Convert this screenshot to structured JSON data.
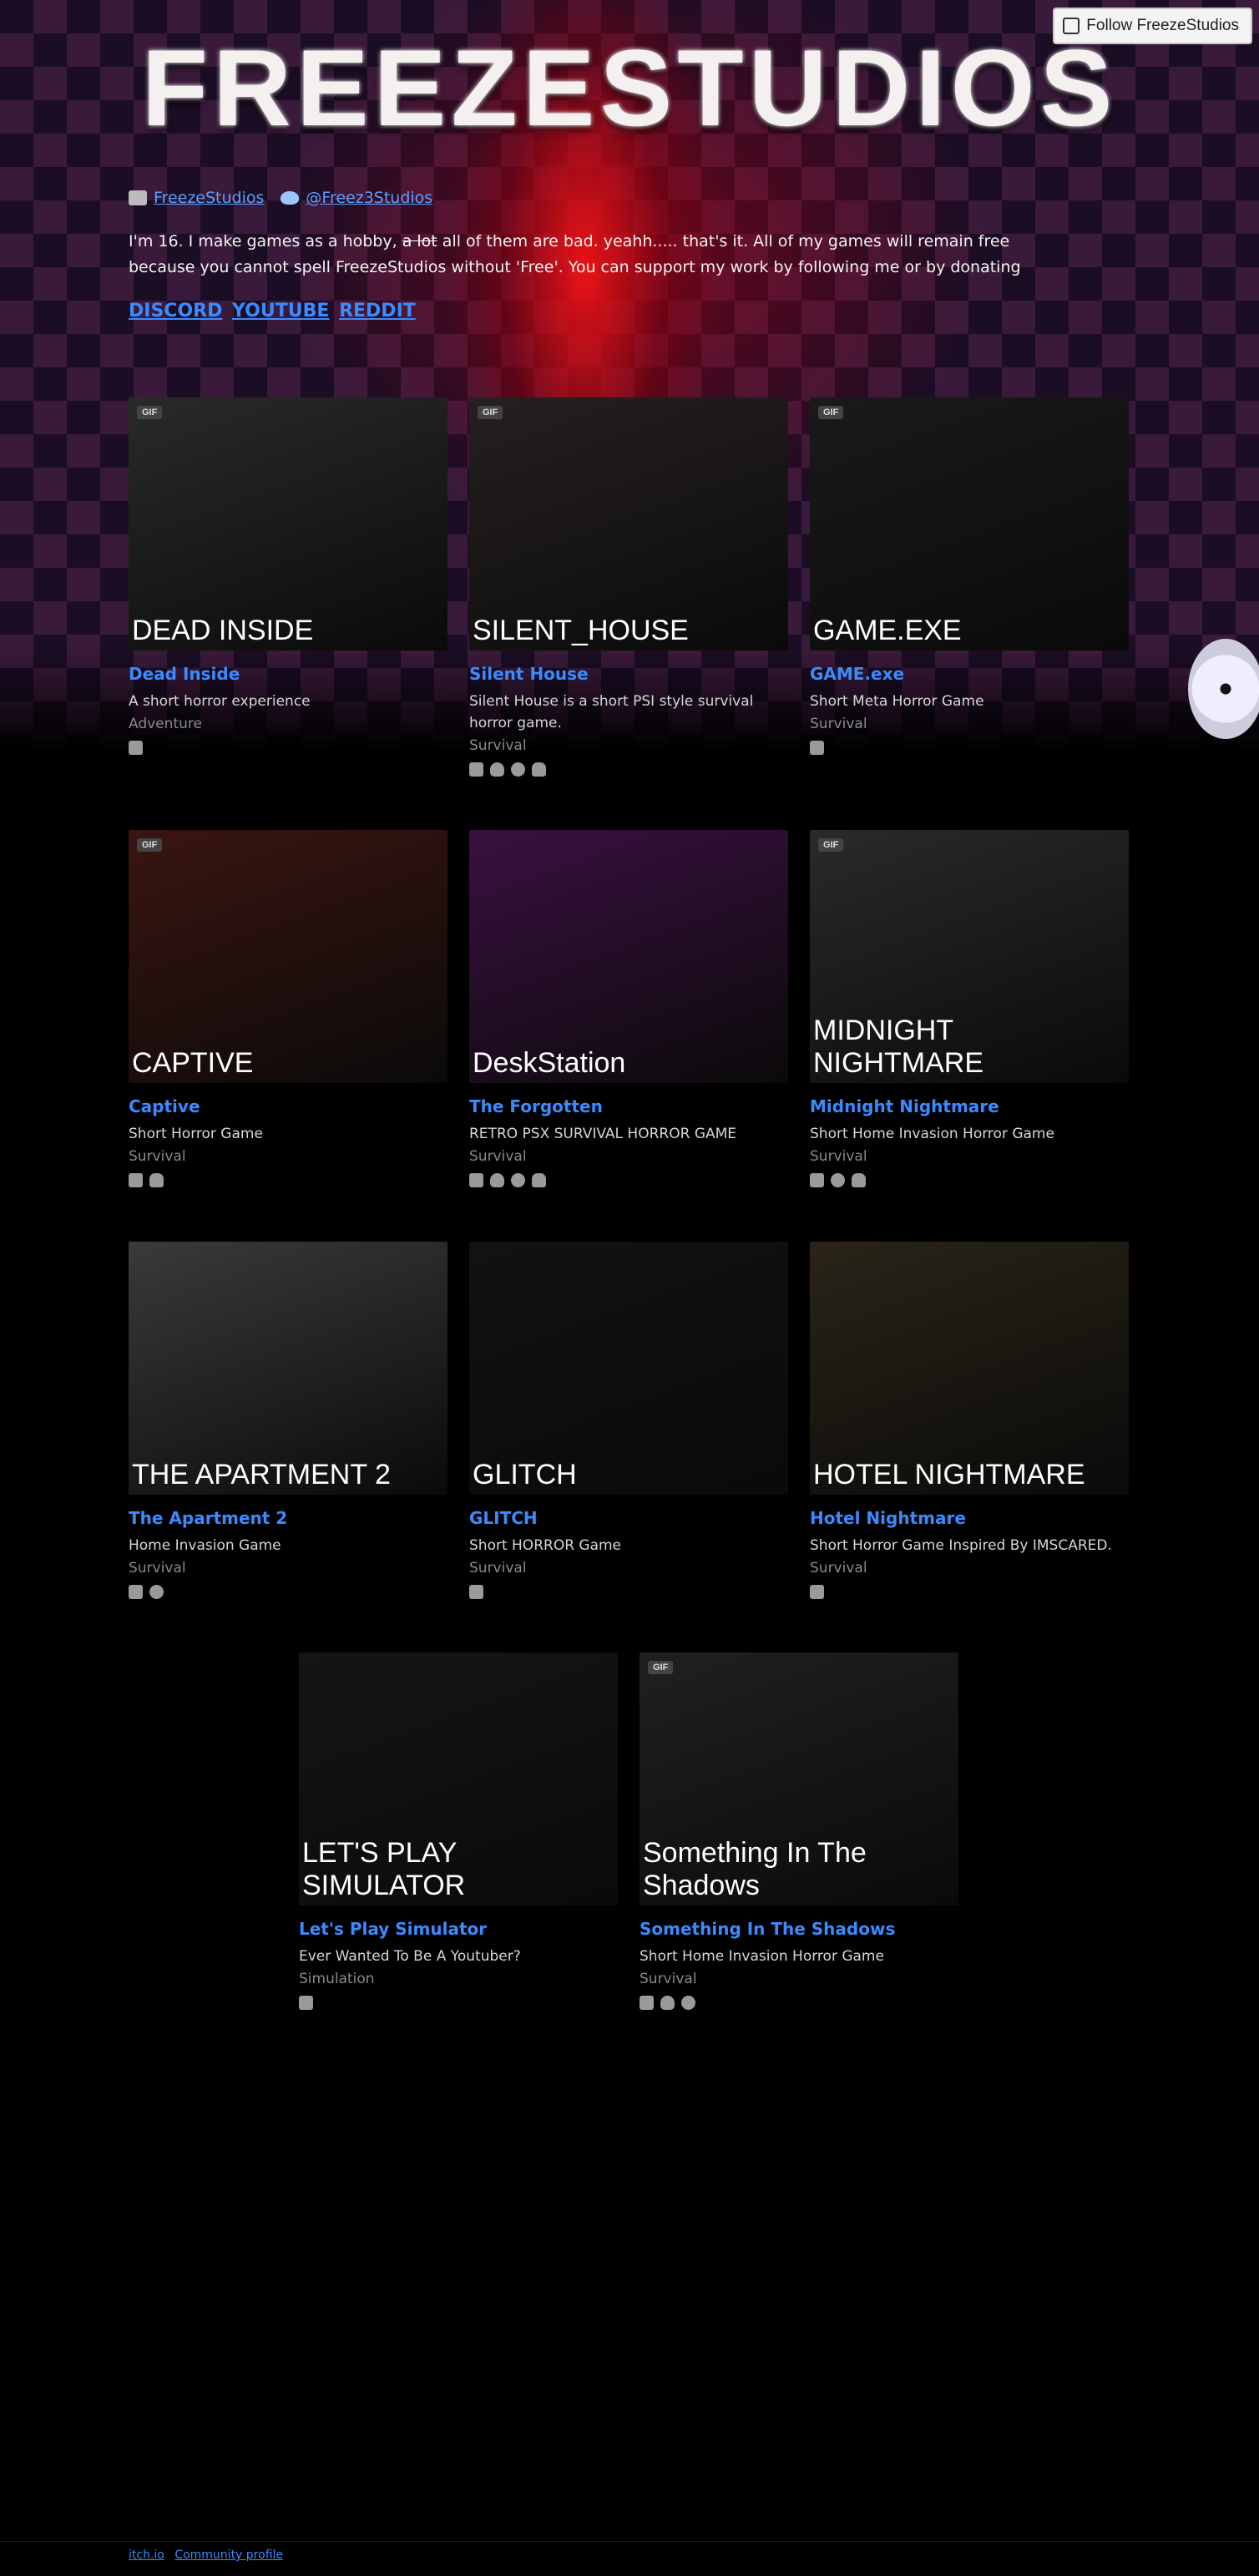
{
  "follow_button": "Follow FreezeStudios",
  "banner_title": "FREEZESTUDIOS",
  "profile_links": {
    "itch": "FreezeStudios",
    "twitter": "@Freez3Studios"
  },
  "bio": {
    "before": "I'm 16. I make games as a hobby,",
    "strike": "a lot",
    "after": "all of them are bad. yeahh..... that's it. All of my games will remain free because you cannot spell FreezeStudios without 'Free'. You can support my work by following me or by donating"
  },
  "site_links": [
    "DISCORD",
    "YOUTUBE",
    "REDDIT"
  ],
  "games": [
    {
      "name": "Dead Inside",
      "desc": "A short horror experience",
      "genre": "Adventure",
      "gif": true,
      "thumb_text": "DEAD INSIDE",
      "platforms": [
        "windows-icon"
      ],
      "color": "#2a2a2a"
    },
    {
      "name": "Silent House",
      "desc": "Silent House is a short PSI style survival horror game.",
      "genre": "Survival",
      "gif": true,
      "thumb_text": "SILENT_HOUSE",
      "platforms": [
        "windows-icon",
        "linux-icon",
        "mac-icon",
        "android-icon"
      ],
      "color": "#262020"
    },
    {
      "name": "GAME.exe",
      "desc": "Short Meta Horror Game",
      "genre": "Survival",
      "gif": true,
      "thumb_text": "GAME.EXE",
      "platforms": [
        "windows-icon"
      ],
      "color": "#1a1a1a"
    },
    {
      "name": "Captive",
      "desc": "Short Horror Game",
      "genre": "Survival",
      "gif": true,
      "thumb_text": "CAPTIVE",
      "platforms": [
        "windows-icon",
        "android-icon"
      ],
      "color": "#3a1510"
    },
    {
      "name": "The Forgotten",
      "desc": "RETRO PSX SURVIVAL HORROR GAME",
      "genre": "Survival",
      "gif": false,
      "thumb_text": "DeskStation",
      "platforms": [
        "windows-icon",
        "linux-icon",
        "mac-icon",
        "android-icon"
      ],
      "color": "#3a1040"
    },
    {
      "name": "Midnight Nightmare",
      "desc": "Short Home Invasion Horror Game",
      "genre": "Survival",
      "gif": true,
      "thumb_text": "MIDNIGHT NIGHTMARE",
      "platforms": [
        "windows-icon",
        "mac-icon",
        "android-icon"
      ],
      "color": "#2a2a2a"
    },
    {
      "name": "The Apartment 2",
      "desc": "Home Invasion Game",
      "genre": "Survival",
      "gif": false,
      "thumb_text": "THE APARTMENT 2",
      "platforms": [
        "windows-icon",
        "mac-icon"
      ],
      "color": "#3a3a3a"
    },
    {
      "name": "GLITCH",
      "desc": "Short HORROR Game",
      "genre": "Survival",
      "gif": false,
      "thumb_text": "GLITCH",
      "platforms": [
        "windows-icon"
      ],
      "color": "#121212"
    },
    {
      "name": "Hotel Nightmare",
      "desc": "Short Horror Game Inspired By IMSCARED.",
      "genre": "Survival",
      "gif": false,
      "thumb_text": "HOTEL NIGHTMARE",
      "platforms": [
        "windows-icon"
      ],
      "color": "#2a2418"
    },
    {
      "name": "Let's Play Simulator",
      "desc": "Ever Wanted To Be A Youtuber?",
      "genre": "Simulation",
      "gif": false,
      "thumb_text": "LET'S PLAY SIMULATOR",
      "platforms": [
        "windows-icon"
      ],
      "color": "#151515"
    },
    {
      "name": "Something In The Shadows",
      "desc": "Short Home Invasion Horror Game",
      "genre": "Survival",
      "gif": true,
      "thumb_text": "Something In The Shadows",
      "platforms": [
        "windows-icon",
        "linux-icon",
        "mac-icon"
      ],
      "color": "#202020"
    }
  ],
  "footer": {
    "itch": "itch.io",
    "community": "Community profile"
  }
}
